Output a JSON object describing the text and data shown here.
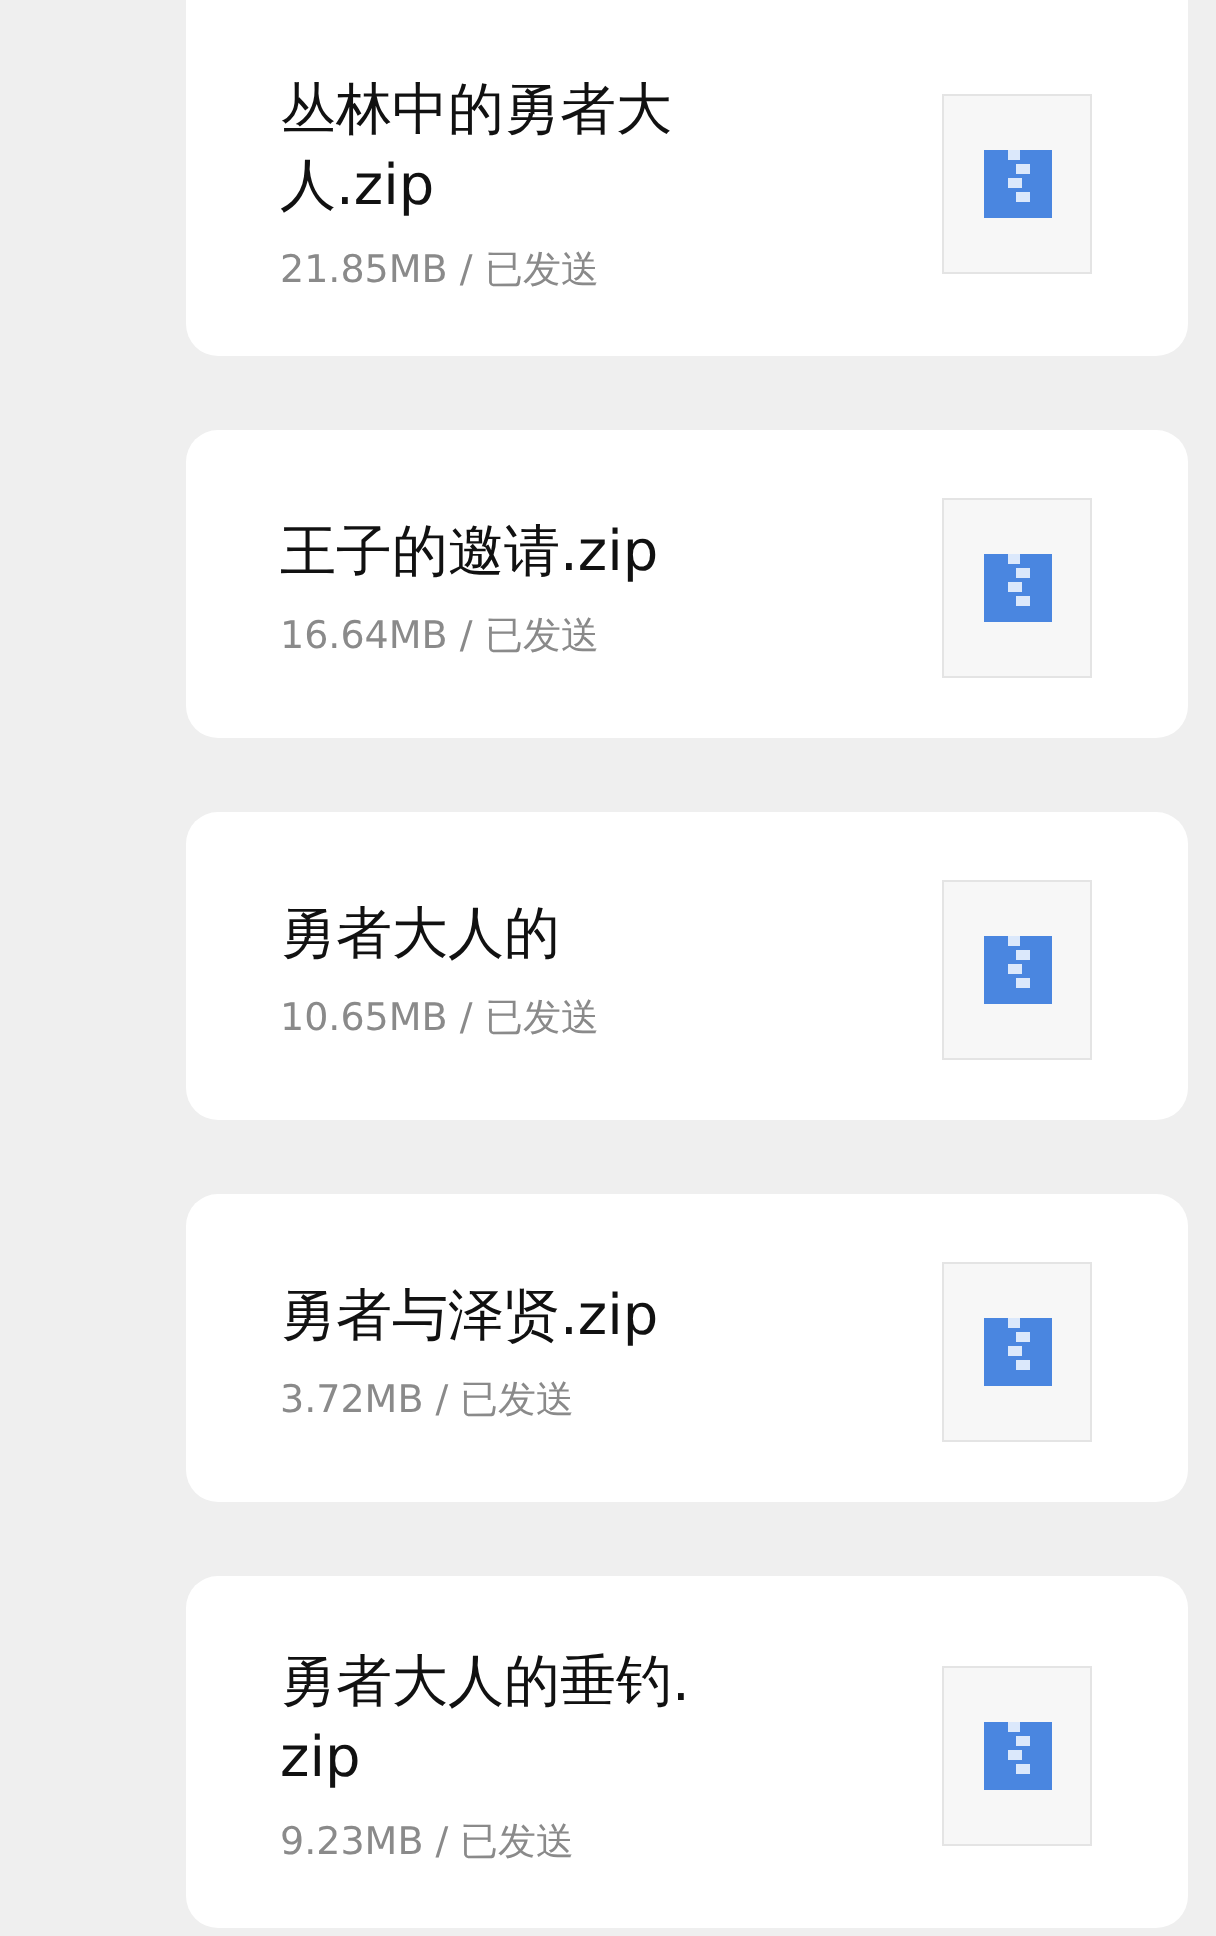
{
  "files": [
    {
      "name": "丛林中的勇者大人.zip",
      "meta": "21.85MB / 已发送"
    },
    {
      "name": "王子的邀请.zip",
      "meta": "16.64MB / 已发送"
    },
    {
      "name": "勇者大人的",
      "meta": "10.65MB / 已发送"
    },
    {
      "name": "勇者与泽贤.zip",
      "meta": "3.72MB / 已发送"
    },
    {
      "name": "勇者大人的垂钓.zip",
      "meta": "9.23MB / 已发送"
    }
  ]
}
